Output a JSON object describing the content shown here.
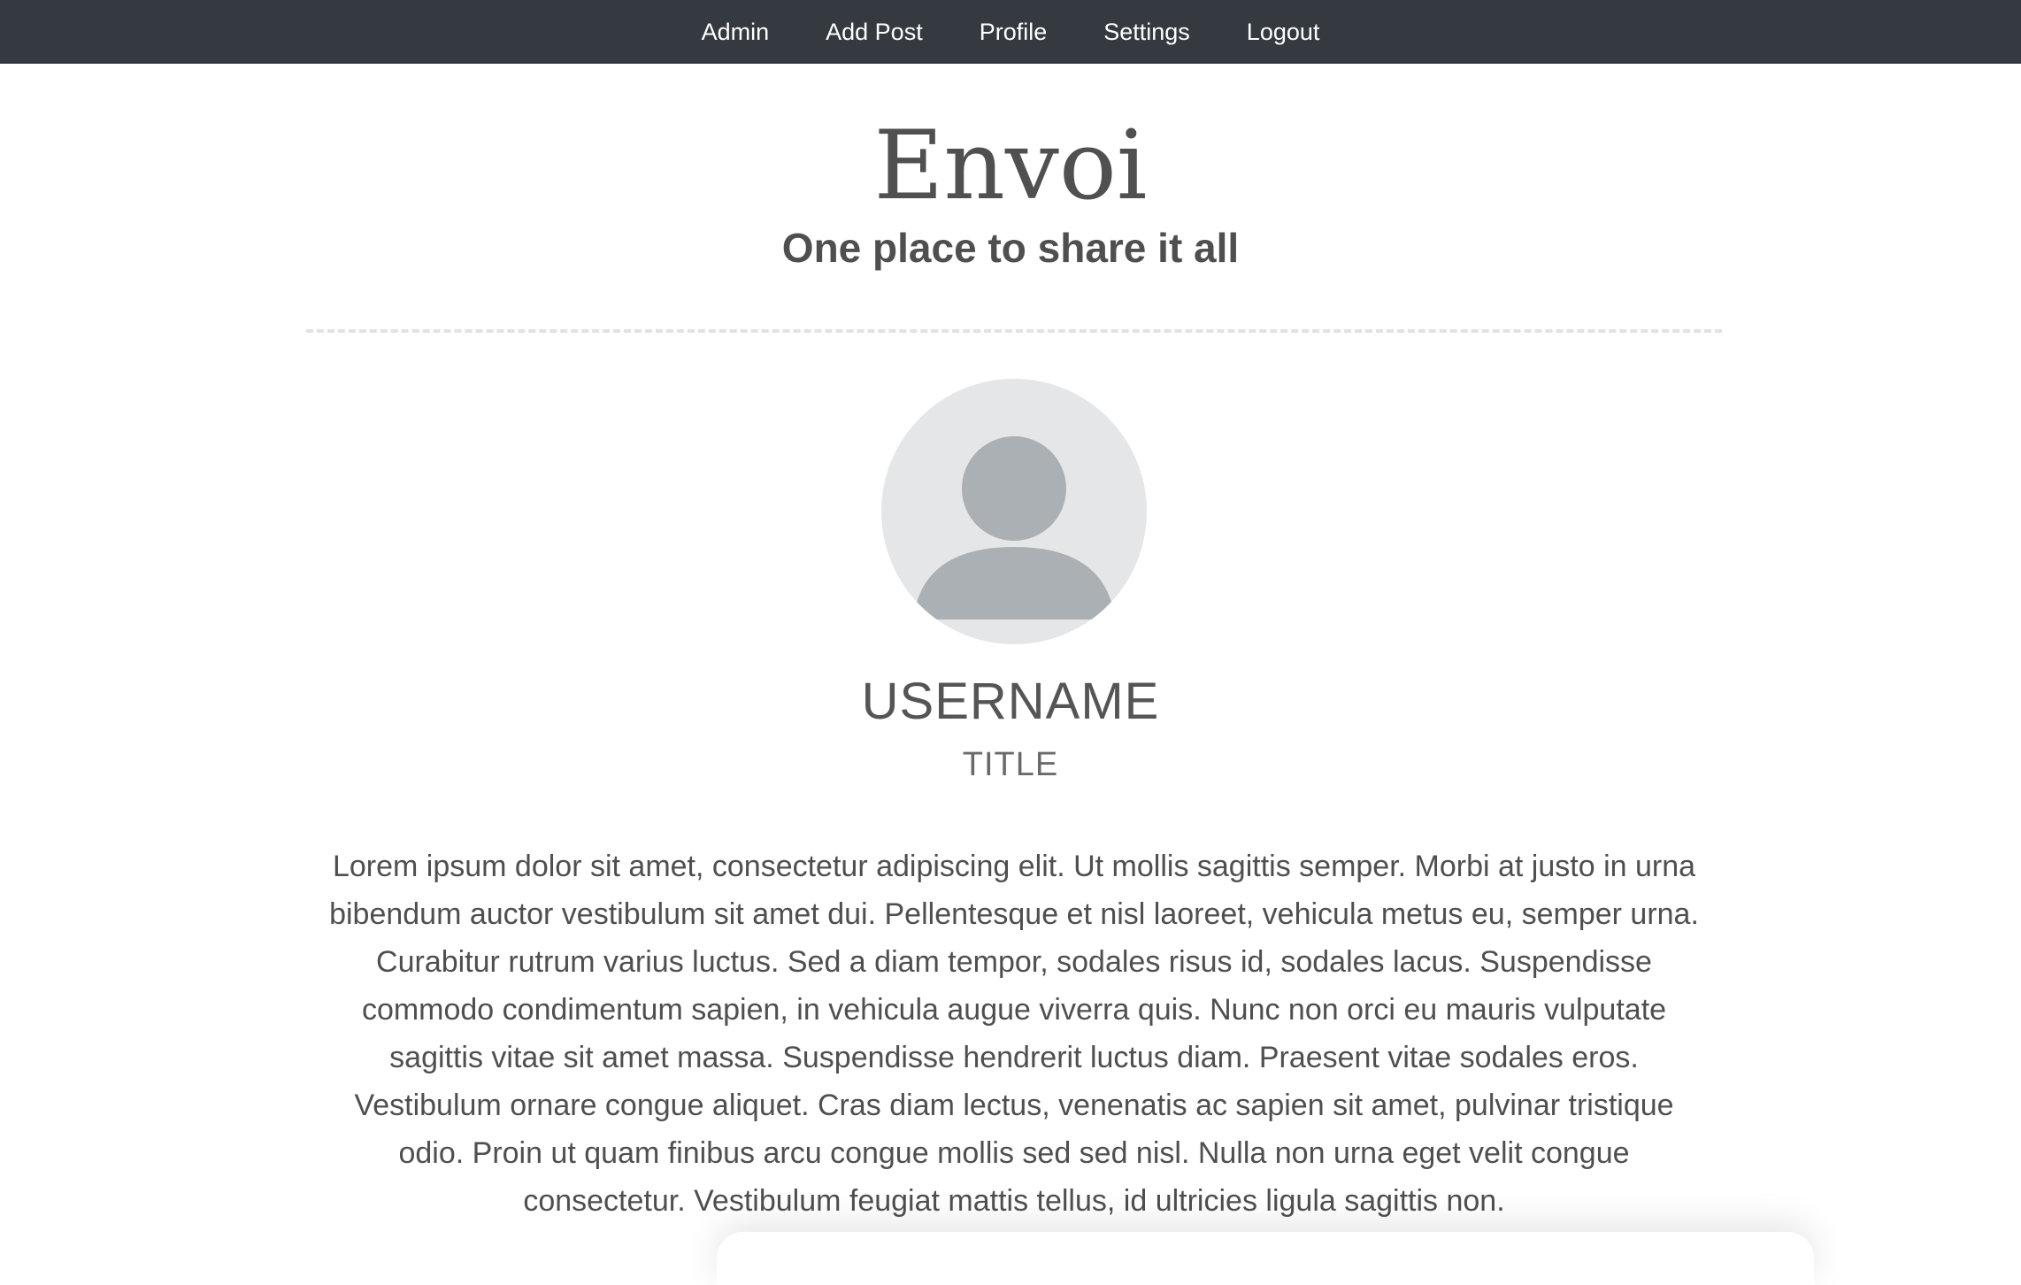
{
  "nav": {
    "items": [
      {
        "label": "Admin"
      },
      {
        "label": "Add Post"
      },
      {
        "label": "Profile"
      },
      {
        "label": "Settings"
      },
      {
        "label": "Logout"
      }
    ],
    "background": "#343a40"
  },
  "header": {
    "brand": "Envoi",
    "tagline": "One place to share it all"
  },
  "profile": {
    "avatar_icon": "user-silhouette-icon",
    "username": "USERNAME",
    "title": "TITLE",
    "bio": "Lorem ipsum dolor sit amet, consectetur adipiscing elit. Ut mollis sagittis semper. Morbi at justo in urna bibendum auctor vestibulum sit amet dui. Pellentesque et nisl laoreet, vehicula metus eu, semper urna. Curabitur rutrum varius luctus. Sed a diam tempor, sodales risus id, sodales lacus. Suspendisse commodo condimentum sapien, in vehicula augue viverra quis. Nunc non orci eu mauris vulputate sagittis vitae sit amet massa. Suspendisse hendrerit luctus diam. Praesent vitae sodales eros. Vestibulum ornare congue aliquet. Cras diam lectus, venenatis ac sapien sit amet, pulvinar tristique odio. Proin ut quam finibus arcu congue mollis sed sed nisl. Nulla non urna eget velit congue consectetur. Vestibulum feugiat mattis tellus, id ultricies ligula sagittis non."
  },
  "colors": {
    "avatar_bg": "#e4e6e8",
    "avatar_fg": "#aab0b3"
  }
}
